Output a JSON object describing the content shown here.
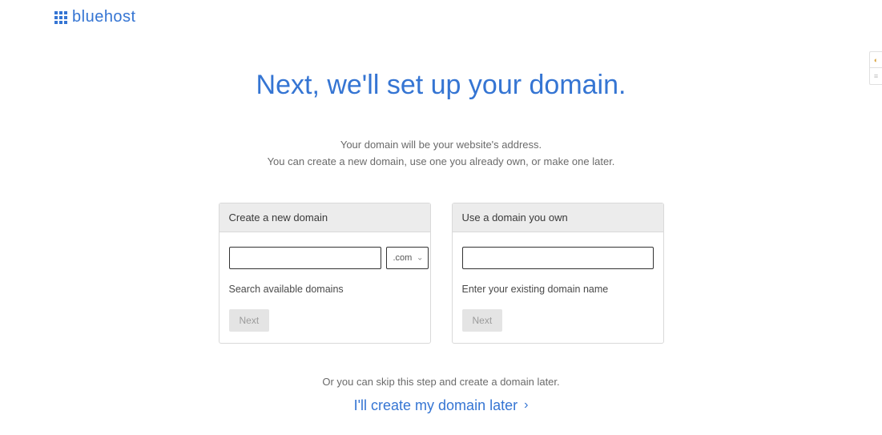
{
  "brand": {
    "name": "bluehost"
  },
  "page": {
    "title": "Next, we'll set up your domain.",
    "subtitle_line1": "Your domain will be your website's address.",
    "subtitle_line2": "You can create a new domain, use one you already own, or make one later."
  },
  "card_create": {
    "header": "Create a new domain",
    "tld_selected": ".com",
    "helper": "Search available domains",
    "button": "Next"
  },
  "card_own": {
    "header": "Use a domain you own",
    "helper": "Enter your existing domain name",
    "button": "Next"
  },
  "skip": {
    "text": "Or you can skip this step and create a domain later.",
    "link": "I'll create my domain later"
  }
}
